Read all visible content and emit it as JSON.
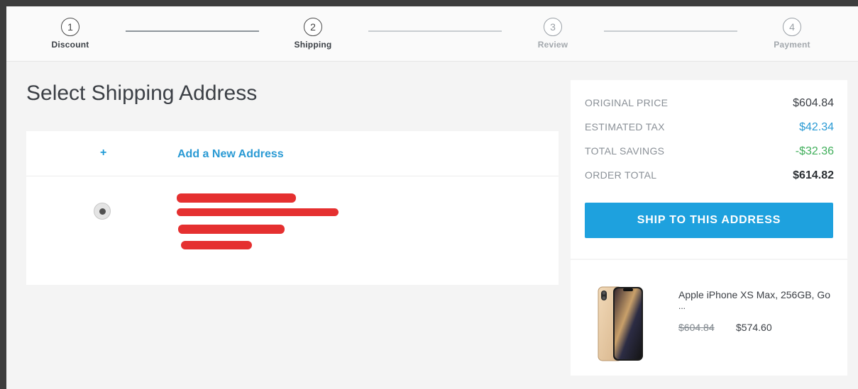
{
  "stepper": {
    "steps": [
      {
        "number": "1",
        "label": "Discount"
      },
      {
        "number": "2",
        "label": "Shipping"
      },
      {
        "number": "3",
        "label": "Review"
      },
      {
        "number": "4",
        "label": "Payment"
      }
    ],
    "current_step": 2
  },
  "main": {
    "title": "Select Shipping Address",
    "add_address": {
      "icon_text": "+",
      "label": "Add a New Address"
    },
    "saved_address": {
      "selected": true,
      "content_state": "redacted"
    }
  },
  "summary": {
    "rows": [
      {
        "label": "ORIGINAL PRICE",
        "value": "$604.84",
        "color": "#3b3f45"
      },
      {
        "label": "ESTIMATED TAX",
        "value": "$42.34",
        "color": "#2a9ad4"
      },
      {
        "label": "TOTAL SAVINGS",
        "value": "-$32.36",
        "color": "#3fae5a"
      },
      {
        "label": "ORDER TOTAL",
        "value": "$614.82",
        "color": "#2b2f33"
      }
    ],
    "ship_button": "SHIP TO THIS ADDRESS"
  },
  "product": {
    "name": "Apple iPhone XS Max, 256GB, Go",
    "ellipsis": "...",
    "original_price": "$604.84",
    "price": "$574.60",
    "image_icon": "iphone-xs-max-gold-image"
  },
  "colors": {
    "accent": "#1ea1de",
    "savings": "#3fae5a",
    "redaction": "#e53030"
  }
}
